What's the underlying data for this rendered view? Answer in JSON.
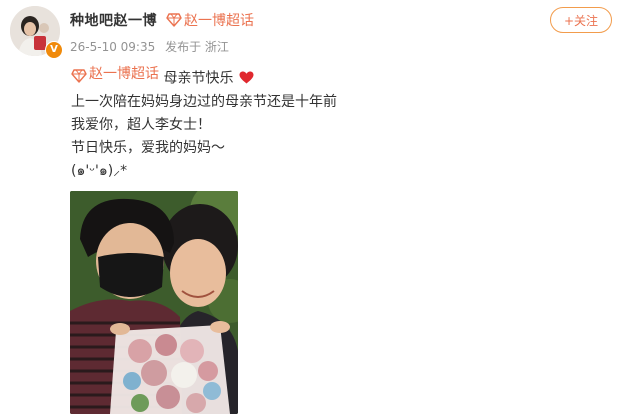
{
  "post": {
    "author": {
      "name": "种地吧赵一博",
      "verified_badge": "V"
    },
    "super_topic_label": "赵一博超话",
    "follow_button": "+关注",
    "meta": {
      "date": "26-5-10 09:35",
      "location": "发布于 浙江"
    },
    "content": {
      "topic_link": "赵一博超话",
      "first_line_text": "母亲节快乐",
      "lines": [
        "上一次陪在妈妈身边过的母亲节还是十年前",
        "我爱你，超人李女士！",
        "节日快乐，爱我的妈妈～",
        "(๑'ᵕ'๑)⸝*"
      ]
    },
    "icons": {
      "topic_icon": "diamond-gem-icon",
      "heart": "red-heart-icon"
    },
    "colors": {
      "accent": "#eb7350",
      "meta_text": "#939393",
      "heart": "#e0282e",
      "badge": "#f08a0b"
    }
  }
}
